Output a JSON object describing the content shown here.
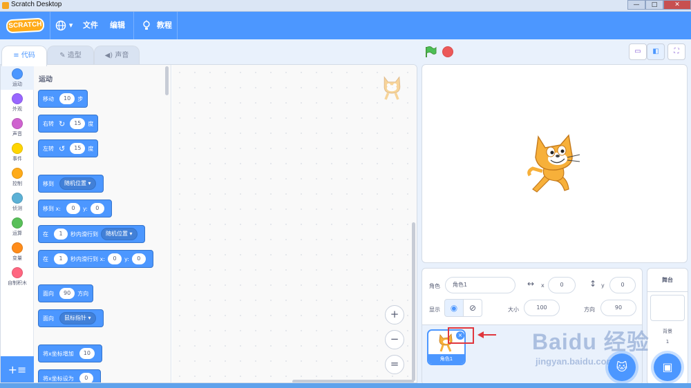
{
  "window": {
    "title": "Scratch Desktop",
    "minimize": "—",
    "maximize": "□",
    "close": "✕"
  },
  "menubar": {
    "logo": "SCRATCH",
    "language_icon": "globe-icon",
    "language_caret": "▾",
    "file": "文件",
    "edit": "编辑",
    "tutorial_icon": "lightbulb-icon",
    "tutorial": "教程"
  },
  "tabs": [
    {
      "icon": "code-icon",
      "glyph": "≡",
      "label": "代码"
    },
    {
      "icon": "brush-icon",
      "glyph": "✎",
      "label": "造型"
    },
    {
      "icon": "speaker-icon",
      "glyph": "◀)",
      "label": "声音"
    }
  ],
  "categories": [
    {
      "label": "运动",
      "color": "#4c97ff"
    },
    {
      "label": "外观",
      "color": "#9966ff"
    },
    {
      "label": "声音",
      "color": "#cf63cf"
    },
    {
      "label": "事件",
      "color": "#ffd500"
    },
    {
      "label": "控制",
      "color": "#ffab19"
    },
    {
      "label": "侦测",
      "color": "#5cb1d6"
    },
    {
      "label": "运算",
      "color": "#59c059"
    },
    {
      "label": "变量",
      "color": "#ff8c1a"
    },
    {
      "label": "自制积木",
      "color": "#ff6680"
    }
  ],
  "extension_button": "+≡",
  "palette": {
    "title": "运动",
    "move": {
      "a": "移动",
      "v": "10",
      "b": "步"
    },
    "turn_right": {
      "a": "右转",
      "icon": "↻",
      "v": "15",
      "b": "度"
    },
    "turn_left": {
      "a": "左转",
      "icon": "↺",
      "v": "15",
      "b": "度"
    },
    "goto": {
      "a": "移到",
      "dd": "随机位置 ▾"
    },
    "goto_xy": {
      "a": "移到 x:",
      "x": "0",
      "y_lbl": "y:",
      "y": "0"
    },
    "glide": {
      "a": "在",
      "v": "1",
      "b": "秒内滑行到",
      "dd": "随机位置 ▾"
    },
    "glide_xy": {
      "a": "在",
      "v": "1",
      "b": "秒内滑行到 x:",
      "x": "0",
      "y_lbl": "y:",
      "y": "0"
    },
    "point": {
      "a": "面向",
      "v": "90",
      "b": "方向"
    },
    "point_towards": {
      "a": "面向",
      "dd": "鼠标指针 ▾"
    },
    "change_x": {
      "a": "将x坐标增加",
      "v": "10"
    },
    "set_x": {
      "a": "将x坐标设为",
      "v": "0"
    }
  },
  "zoom": {
    "in": "+",
    "out": "−",
    "reset": "="
  },
  "stage_header": {
    "small_stage": "▭",
    "normal_stage": "◧",
    "fullscreen": "⛶"
  },
  "sprite_info": {
    "sprite_label": "角色",
    "sprite_name": "角色1",
    "x_icon": "↔",
    "x_label": "x",
    "x": "0",
    "y_icon": "↕",
    "y_label": "y",
    "y": "0",
    "show_label": "显示",
    "show_icon": "◉",
    "hide_icon": "⊘",
    "size_label": "大小",
    "size": "100",
    "direction_label": "方向",
    "direction": "90"
  },
  "sprites": [
    {
      "name": "角色1",
      "delete": "×"
    }
  ],
  "stage_pane": {
    "title": "舞台",
    "backdrop_label": "背景",
    "backdrop_count": "1"
  },
  "fab": {
    "sprite": "🐱",
    "backdrop": "▣"
  },
  "watermark": {
    "line1": "Baidu 经验",
    "line2": "jingyan.baidu.com"
  }
}
